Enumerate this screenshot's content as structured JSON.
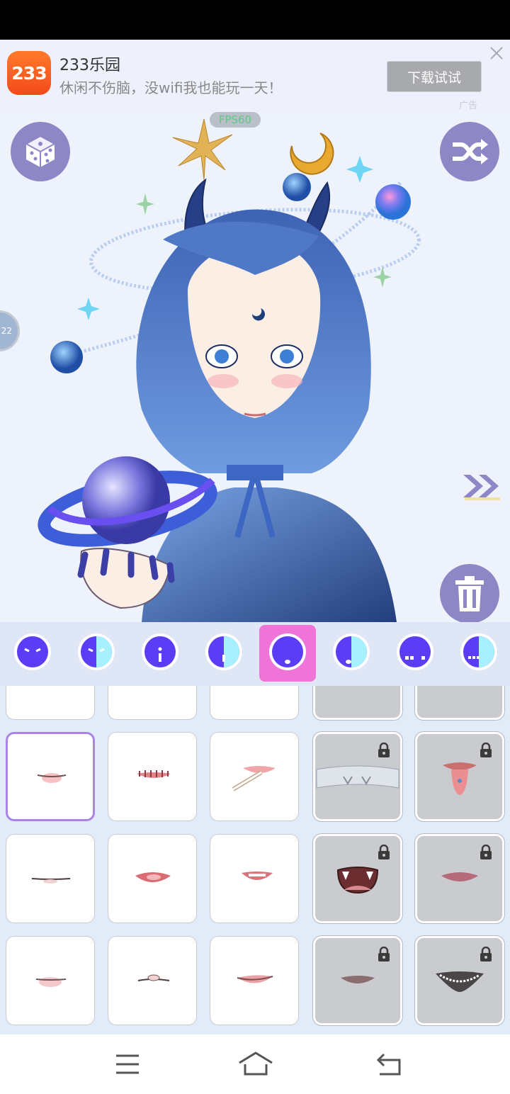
{
  "ad": {
    "logo_text": "233",
    "title": "233乐园",
    "subtitle": "休闲不伤脑，没wifi我也能玩一天！",
    "download_label": "下载试试",
    "tag": "广告"
  },
  "canvas": {
    "fps": "FPS60",
    "side_tab": "22"
  },
  "toolbar": {
    "selected_index": 4,
    "accent": "#5b3df5",
    "highlight": "#f074d8",
    "tools": [
      {
        "name": "eye-style-1"
      },
      {
        "name": "eye-style-2"
      },
      {
        "name": "eye-style-3"
      },
      {
        "name": "eye-style-4"
      },
      {
        "name": "eye-style-5"
      },
      {
        "name": "eye-style-6"
      },
      {
        "name": "eye-style-7"
      },
      {
        "name": "eye-style-8"
      }
    ]
  },
  "mouth_grid": {
    "selected_index": 0,
    "items": [
      {
        "name": "mouth-1",
        "locked": false
      },
      {
        "name": "mouth-2",
        "locked": false
      },
      {
        "name": "mouth-3",
        "locked": false
      },
      {
        "name": "mouth-4",
        "locked": true
      },
      {
        "name": "mouth-5",
        "locked": true
      },
      {
        "name": "mouth-6",
        "locked": false
      },
      {
        "name": "mouth-7",
        "locked": false
      },
      {
        "name": "mouth-8",
        "locked": false
      },
      {
        "name": "mouth-9",
        "locked": true
      },
      {
        "name": "mouth-10",
        "locked": true
      },
      {
        "name": "mouth-11",
        "locked": false
      },
      {
        "name": "mouth-12",
        "locked": false
      },
      {
        "name": "mouth-13",
        "locked": false
      },
      {
        "name": "mouth-14",
        "locked": true
      },
      {
        "name": "mouth-15",
        "locked": true
      }
    ]
  },
  "colors": {
    "ad_orange": "#f24a1a",
    "round_button": "#8e87c6",
    "hair_blue": "#5a86d0",
    "lock_gray": "#c9cbce"
  }
}
